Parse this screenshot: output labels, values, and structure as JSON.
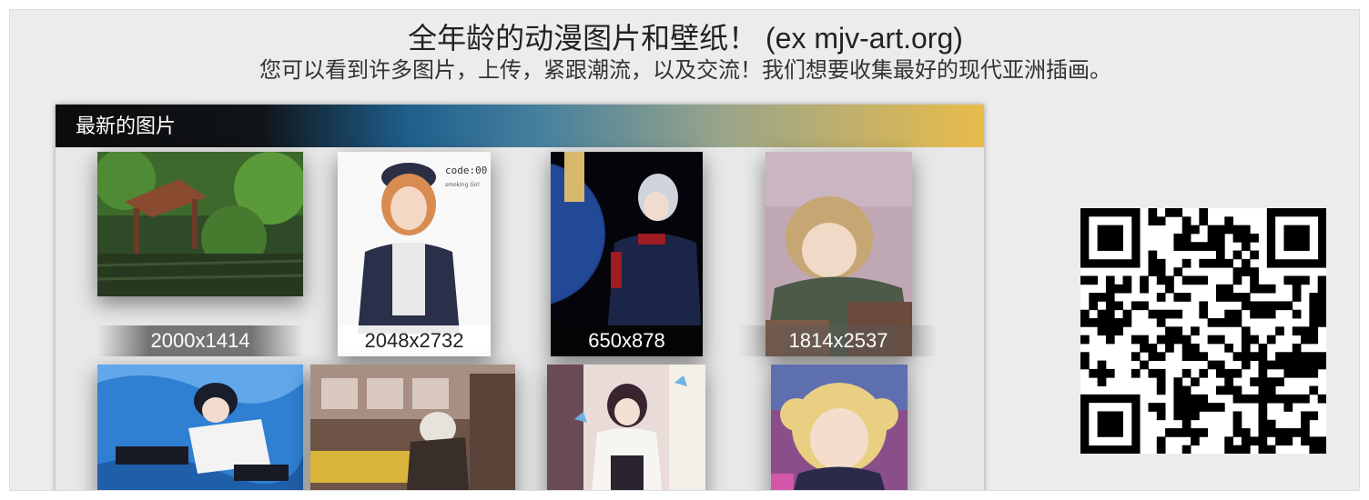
{
  "header": {
    "title": "全年龄的动漫图片和壁纸！ (ex mjv-art.org)",
    "subtitle": "您可以看到许多图片，上传，紧跟潮流，以及交流！我们想要收集最好的现代亚洲插画。"
  },
  "latest": {
    "title": "最新的图片",
    "images": [
      {
        "size": "2000x1414",
        "subject": "forest-pavilion"
      },
      {
        "size": "2048x2732",
        "subject": "girl-with-cap"
      },
      {
        "size": "650x878",
        "subject": "boy-in-uniform-night"
      },
      {
        "size": "1814x2537",
        "subject": "girl-at-desk"
      },
      {
        "subject": "boy-in-water"
      },
      {
        "subject": "train-scene"
      },
      {
        "subject": "girl-with-butterflies"
      },
      {
        "subject": "blonde-girl"
      }
    ]
  },
  "qr": {
    "icon": "qr-code-icon"
  },
  "colors": {
    "accent_gold": "#e9bc4a",
    "accent_blue": "#1f5f8c",
    "page_bg": "#ececec"
  }
}
